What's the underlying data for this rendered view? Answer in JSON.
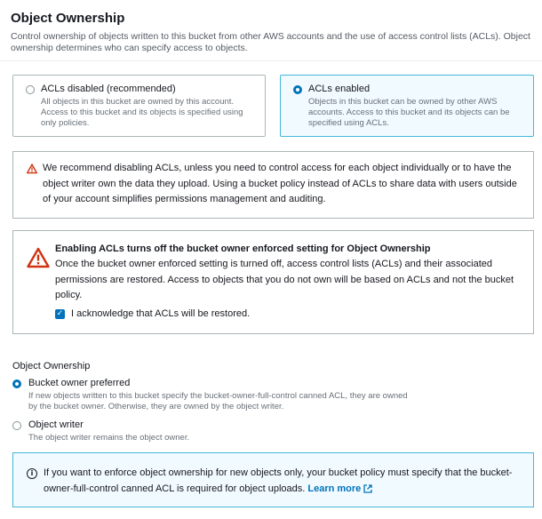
{
  "header": {
    "title": "Object Ownership",
    "description": "Control ownership of objects written to this bucket from other AWS accounts and the use of access control lists (ACLs). Object ownership determines who can specify access to objects."
  },
  "acl_options": [
    {
      "label": "ACLs disabled (recommended)",
      "description": "All objects in this bucket are owned by this account. Access to this bucket and its objects is specified using only policies.",
      "selected": false
    },
    {
      "label": "ACLs enabled",
      "description": "Objects in this bucket can be owned by other AWS accounts. Access to this bucket and its objects can be specified using ACLs.",
      "selected": true
    }
  ],
  "recommendation": {
    "text": "We recommend disabling ACLs, unless you need to control access for each object individually or to have the object writer own the data they upload. Using a bucket policy instead of ACLs to share data with users outside of your account simplifies permissions management and auditing."
  },
  "enforced_warning": {
    "title": "Enabling ACLs turns off the bucket owner enforced setting for Object Ownership",
    "text": "Once the bucket owner enforced setting is turned off, access control lists (ACLs) and their associated permissions are restored. Access to objects that you do not own will be based on ACLs and not the bucket policy.",
    "acknowledge_label": "I acknowledge that ACLs will be restored.",
    "acknowledged": true
  },
  "ownership": {
    "label": "Object Ownership",
    "options": [
      {
        "label": "Bucket owner preferred",
        "description": "If new objects written to this bucket specify the bucket-owner-full-control canned ACL, they are owned by the bucket owner. Otherwise, they are owned by the object writer.",
        "selected": true
      },
      {
        "label": "Object writer",
        "description": "The object writer remains the object owner.",
        "selected": false
      }
    ]
  },
  "info": {
    "text": "If you want to enforce object ownership for new objects only, your bucket policy must specify that the bucket-owner-full-control canned ACL is required for object uploads.",
    "link": "Learn more"
  },
  "colors": {
    "accent": "#0073bb",
    "warning": "#d13212",
    "selected_border": "#44b9d6",
    "selected_bg": "#f1faff"
  },
  "icons": [
    "warning-icon",
    "info-icon",
    "external-link-icon",
    "checkmark-icon"
  ]
}
